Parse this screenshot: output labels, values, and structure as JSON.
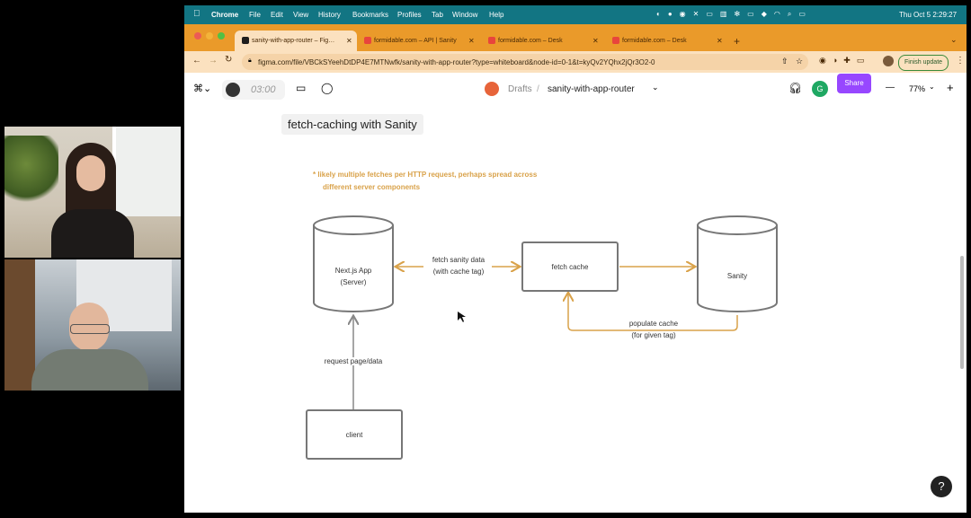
{
  "menubar": {
    "items": [
      "Chrome",
      "File",
      "Edit",
      "View",
      "History",
      "Bookmarks",
      "Profiles",
      "Tab",
      "Window",
      "Help"
    ],
    "clock": "Thu Oct 5  2:29:27"
  },
  "tabs": [
    {
      "label": "sanity-with-app-router – Fig…",
      "fav_color": "#1e1e1e"
    },
    {
      "label": "formidable.com – API | Sanity",
      "fav_color": "#e8453c"
    },
    {
      "label": "formidable.com – Desk",
      "fav_color": "#e8453c"
    },
    {
      "label": "formidable.com – Desk",
      "fav_color": "#e8453c"
    }
  ],
  "address": {
    "url": "figma.com/file/VBCkSYeehDtDP4E7MTNwfk/sanity-with-app-router?type=whiteboard&node-id=0-1&t=kyQv2YQhx2jQr3O2-0",
    "finish_update": "Finish update"
  },
  "figma": {
    "timer": "03:00",
    "breadcrumb_parent": "Drafts",
    "breadcrumb_sep": "/",
    "file_name": "sanity-with-app-router",
    "avatar_initial": "G",
    "share_label": "Share",
    "zoom": "77%",
    "zoom_minus": "—",
    "zoom_plus": "+"
  },
  "diagram": {
    "title": "fetch-caching with Sanity",
    "note_line1": "* likely multiple fetches per HTTP request, perhaps spread across",
    "note_line2": "different server components",
    "nextjs_line1": "Next.js App",
    "nextjs_line2": "(Server)",
    "fetch_cache": "fetch cache",
    "sanity": "Sanity",
    "client": "client",
    "arrow_fetch_line1": "fetch sanity data",
    "arrow_fetch_line2": "(with cache tag)",
    "arrow_populate_line1": "populate cache",
    "arrow_populate_line2": "(for given tag)",
    "arrow_request": "request page/data"
  },
  "help_label": "?",
  "colors": {
    "menubar": "#127583",
    "tabbar": "#ea9a2a",
    "arrow_orange": "#d9a24a",
    "share": "#9747ff"
  }
}
